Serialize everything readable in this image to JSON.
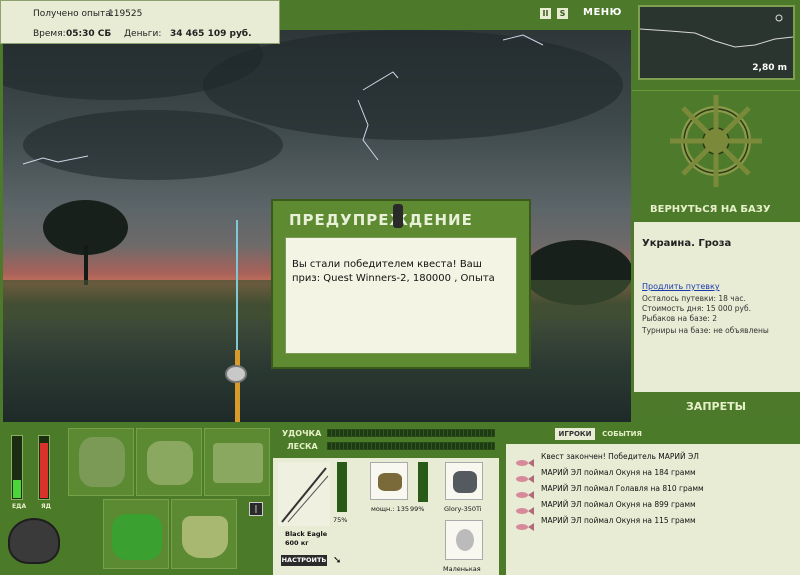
{
  "info": {
    "xp_label": "Получено опыта:",
    "xp_value": "119525",
    "time_label": "Время:",
    "time_value": "05:30 СБ",
    "money_label": "Деньги:",
    "money_value": "34 465 109 руб."
  },
  "topbar": {
    "pause_label": "II",
    "sound_label": "S",
    "menu_label": "МЕНЮ"
  },
  "minimap": {
    "depth": "2,80 m"
  },
  "helm": {
    "label": "ВЕРНУТЬСЯ НА БАЗУ"
  },
  "base": {
    "title": "Украина. Гроза",
    "extend_link": "Продлить путевку",
    "lines": [
      "Осталось путевки: 18 час.",
      "Стоимость дня: 15 000 руб.",
      "Рыбаков на базе: 2",
      "Турниры на базе: не объявлены"
    ]
  },
  "bans": {
    "label": "ЗАПРЕТЫ"
  },
  "modal": {
    "title": "ПРЕДУПРЕЖДЕНИЕ",
    "body": "Вы стали победителем квеста! Ваш приз: Quest Winners-2, 180000 , Опыта"
  },
  "meters": {
    "food_label": "ЕДА",
    "poison_label": "ЯД",
    "food_level": 0.28,
    "poison_level": 0.88,
    "food_color": "#4bd53a",
    "poison_color": "#d9322a"
  },
  "rod": {
    "rod_label": "УДОЧКА",
    "line_label": "ЛЕСКА",
    "rod_name": "Black Eagle",
    "rod_weight": "600 кг",
    "setup_button": "НАСТРОИТЬ",
    "rod_percent": "75%",
    "reel_power": "мощн.: 135",
    "reel_percent": "99%",
    "line_name": "Glory-350Ti",
    "hook_name": "Маленькая"
  },
  "events": {
    "tab_players": "ИГРОКИ",
    "tab_events": "СОБЫТИЯ",
    "items": [
      "Квест закончен! Победитель МАРИЙ ЭЛ",
      "МАРИЙ ЭЛ поймал Окуня на 184 грамм",
      "МАРИЙ ЭЛ поймал Голавля на 810 грамм",
      "МАРИЙ ЭЛ поймал Окуня на 899 грамм",
      "МАРИЙ ЭЛ поймал Окуня на 115 грамм"
    ]
  },
  "colors": {
    "panel_green": "#4b7a28",
    "panel_light": "#e9ecd5",
    "title_text": "#e6f0c8"
  }
}
